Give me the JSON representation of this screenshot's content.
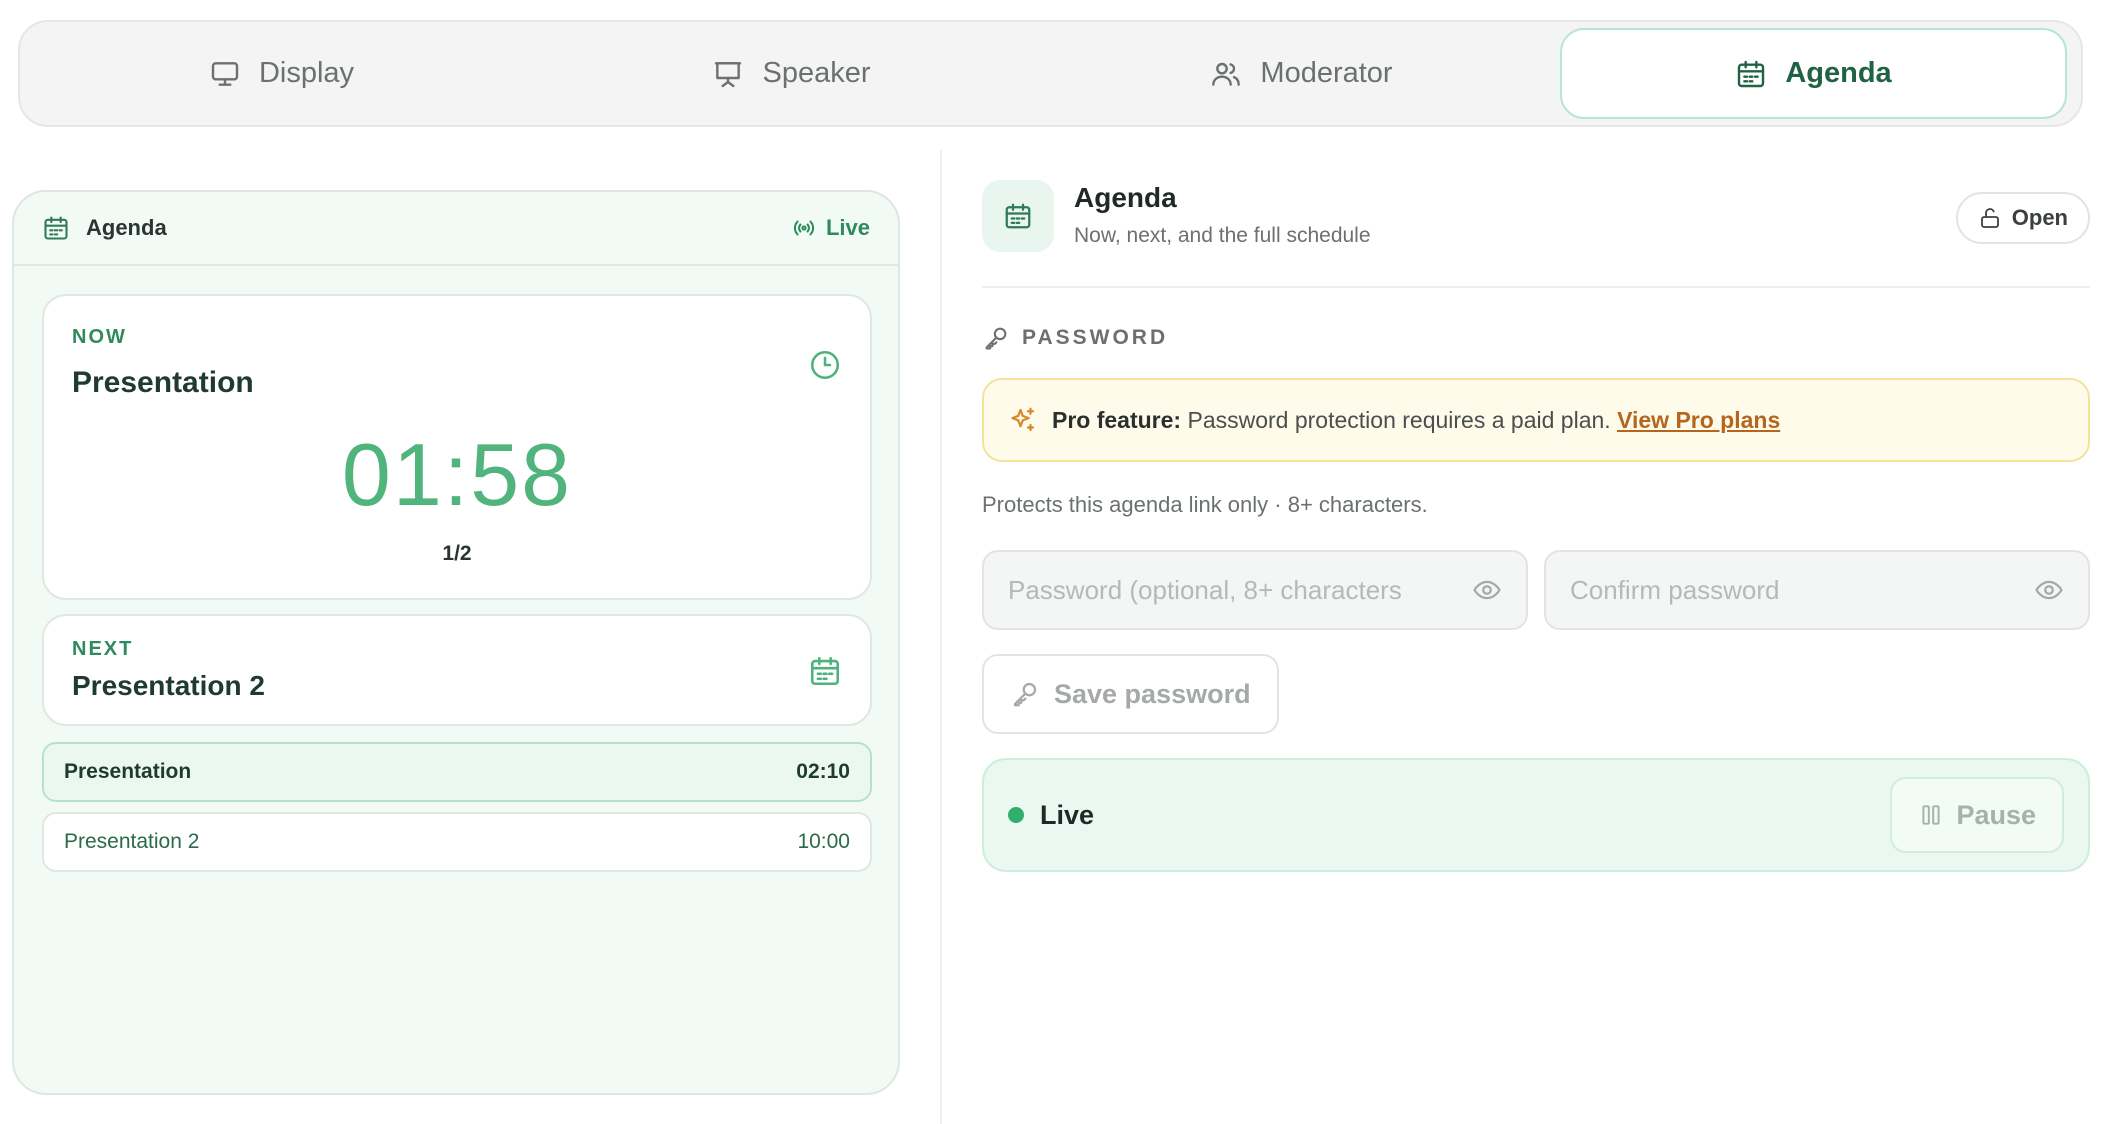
{
  "tabs": [
    {
      "label": "Display",
      "icon": "monitor-icon"
    },
    {
      "label": "Speaker",
      "icon": "presentation-icon"
    },
    {
      "label": "Moderator",
      "icon": "users-icon"
    },
    {
      "label": "Agenda",
      "icon": "calendar-icon",
      "active": true
    }
  ],
  "preview": {
    "title": "Agenda",
    "status": "Live",
    "now": {
      "eyebrow": "NOW",
      "title": "Presentation",
      "timer": "01:58",
      "counter": "1/2"
    },
    "next": {
      "eyebrow": "NEXT",
      "title": "Presentation 2"
    },
    "items": [
      {
        "title": "Presentation",
        "duration": "02:10"
      },
      {
        "title": "Presentation 2",
        "duration": "10:00"
      }
    ]
  },
  "settings": {
    "title": "Agenda",
    "subtitle": "Now, next, and the full schedule",
    "open_label": "Open",
    "password_label": "PASSWORD",
    "pro_label": "Pro feature:",
    "pro_text": "Password protection requires a paid plan.",
    "pro_link": "View Pro plans",
    "hint": "Protects this agenda link only · 8+ characters.",
    "password_placeholder": "Password (optional, 8+ characters",
    "confirm_placeholder": "Confirm password",
    "save_label": "Save password",
    "live_label": "Live",
    "pause_label": "Pause"
  },
  "colors": {
    "accent": "#2f8a5e",
    "timer": "#52b47d",
    "pro_link": "#b5651d"
  }
}
